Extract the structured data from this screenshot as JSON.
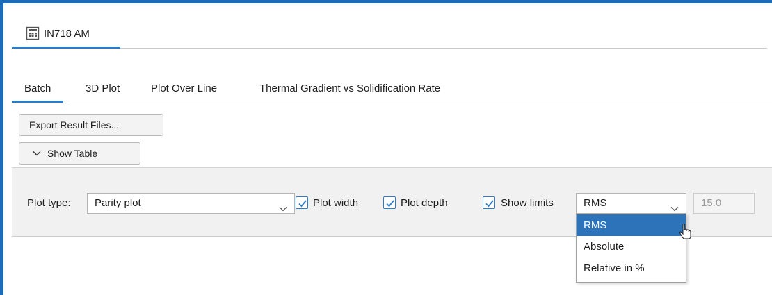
{
  "document_tab": {
    "label": "IN718 AM",
    "icon": "calculator-icon"
  },
  "subtabs": [
    {
      "label": "Batch",
      "active": true
    },
    {
      "label": "3D Plot",
      "active": false
    },
    {
      "label": "Plot Over Line",
      "active": false
    },
    {
      "label": "Thermal Gradient vs Solidification Rate",
      "active": false
    }
  ],
  "buttons": {
    "export": "Export Result Files...",
    "show_table": "Show Table"
  },
  "options": {
    "plot_type_label": "Plot type:",
    "plot_type_value": "Parity plot",
    "plot_width_label": "Plot width",
    "plot_width_checked": true,
    "plot_depth_label": "Plot depth",
    "plot_depth_checked": true,
    "show_limits_label": "Show limits",
    "show_limits_checked": true,
    "limit_mode_value": "RMS",
    "limit_value": "15.0"
  },
  "limit_mode_options": [
    {
      "label": "RMS",
      "selected": true
    },
    {
      "label": "Absolute",
      "selected": false
    },
    {
      "label": "Relative in %",
      "selected": false
    }
  ],
  "colors": {
    "accent": "#2c7bc9",
    "selection": "#2c73b9",
    "frame": "#1c6bb8"
  }
}
